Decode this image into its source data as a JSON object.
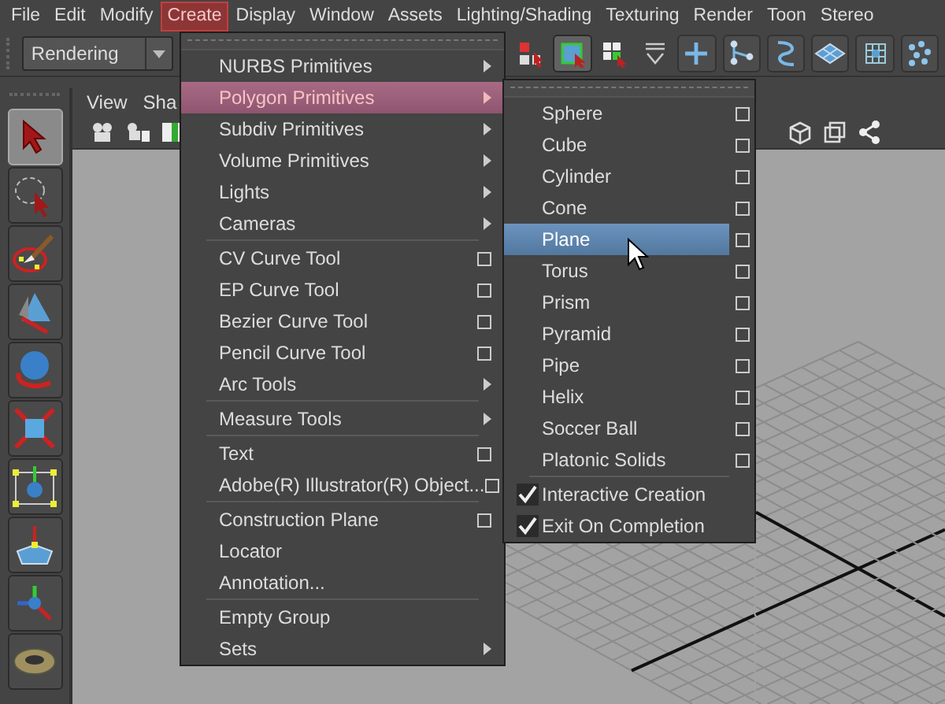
{
  "menubar": [
    {
      "label": "File",
      "selected": false
    },
    {
      "label": "Edit",
      "selected": false
    },
    {
      "label": "Modify",
      "selected": false
    },
    {
      "label": "Create",
      "selected": true
    },
    {
      "label": "Display",
      "selected": false
    },
    {
      "label": "Window",
      "selected": false
    },
    {
      "label": "Assets",
      "selected": false
    },
    {
      "label": "Lighting/Shading",
      "selected": false
    },
    {
      "label": "Texturing",
      "selected": false
    },
    {
      "label": "Render",
      "selected": false
    },
    {
      "label": "Toon",
      "selected": false
    },
    {
      "label": "Stereo",
      "selected": false
    }
  ],
  "toolbar": {
    "menu_set": "Rendering",
    "icons": [
      {
        "kind": "hierarchy",
        "selected": false
      },
      {
        "kind": "object",
        "selected": true
      },
      {
        "kind": "component",
        "selected": false
      },
      {
        "kind": "snap",
        "selected": false
      },
      {
        "kind": "plus",
        "selected": false
      },
      {
        "kind": "joint",
        "selected": false
      },
      {
        "kind": "curve",
        "selected": false
      },
      {
        "kind": "plane",
        "selected": false
      },
      {
        "kind": "lattice",
        "selected": false
      },
      {
        "kind": "particles",
        "selected": false
      }
    ]
  },
  "tools": [
    {
      "kind": "select",
      "selected": true
    },
    {
      "kind": "lasso",
      "selected": false
    },
    {
      "kind": "paint",
      "selected": false
    },
    {
      "kind": "move",
      "selected": false
    },
    {
      "kind": "rotate",
      "selected": false
    },
    {
      "kind": "scale",
      "selected": false
    },
    {
      "kind": "manipulator",
      "selected": false
    },
    {
      "kind": "soft",
      "selected": false
    },
    {
      "kind": "axes",
      "selected": false
    },
    {
      "kind": "torus",
      "selected": false
    }
  ],
  "panel_menu": [
    "View",
    "Sha"
  ],
  "create_menu": [
    [
      {
        "label": "NURBS Primitives",
        "kind": "submenu",
        "selected": false
      },
      {
        "label": "Polygon Primitives",
        "kind": "submenu",
        "selected": true
      },
      {
        "label": "Subdiv Primitives",
        "kind": "submenu",
        "selected": false
      },
      {
        "label": "Volume Primitives",
        "kind": "submenu",
        "selected": false
      },
      {
        "label": "Lights",
        "kind": "submenu",
        "selected": false
      },
      {
        "label": "Cameras",
        "kind": "submenu",
        "selected": false
      }
    ],
    [
      {
        "label": "CV Curve Tool",
        "kind": "option",
        "selected": false
      },
      {
        "label": "EP Curve Tool",
        "kind": "option",
        "selected": false
      },
      {
        "label": "Bezier Curve Tool",
        "kind": "option",
        "selected": false
      },
      {
        "label": "Pencil Curve Tool",
        "kind": "option",
        "selected": false
      },
      {
        "label": "Arc Tools",
        "kind": "submenu",
        "selected": false
      }
    ],
    [
      {
        "label": "Measure Tools",
        "kind": "submenu",
        "selected": false
      }
    ],
    [
      {
        "label": "Text",
        "kind": "option",
        "selected": false
      },
      {
        "label": "Adobe(R) Illustrator(R) Object...",
        "kind": "option",
        "selected": false
      }
    ],
    [
      {
        "label": "Construction Plane",
        "kind": "option",
        "selected": false
      },
      {
        "label": "Locator",
        "kind": "plain",
        "selected": false
      },
      {
        "label": "Annotation...",
        "kind": "plain",
        "selected": false
      }
    ],
    [
      {
        "label": "Empty Group",
        "kind": "plain",
        "selected": false
      },
      {
        "label": "Sets",
        "kind": "submenu",
        "selected": false
      }
    ]
  ],
  "polygon_menu": [
    [
      {
        "label": "Sphere",
        "kind": "option",
        "selected": false
      },
      {
        "label": "Cube",
        "kind": "option",
        "selected": false
      },
      {
        "label": "Cylinder",
        "kind": "option",
        "selected": false
      },
      {
        "label": "Cone",
        "kind": "option",
        "selected": false
      },
      {
        "label": "Plane",
        "kind": "option",
        "selected": true
      },
      {
        "label": "Torus",
        "kind": "option",
        "selected": false
      },
      {
        "label": "Prism",
        "kind": "option",
        "selected": false
      },
      {
        "label": "Pyramid",
        "kind": "option",
        "selected": false
      },
      {
        "label": "Pipe",
        "kind": "option",
        "selected": false
      },
      {
        "label": "Helix",
        "kind": "option",
        "selected": false
      },
      {
        "label": "Soccer Ball",
        "kind": "option",
        "selected": false
      },
      {
        "label": "Platonic Solids",
        "kind": "option",
        "selected": false
      }
    ],
    [
      {
        "label": "Interactive Creation",
        "kind": "check",
        "checked": true,
        "selected": false
      },
      {
        "label": "Exit On Completion",
        "kind": "check",
        "checked": true,
        "selected": false
      }
    ]
  ]
}
